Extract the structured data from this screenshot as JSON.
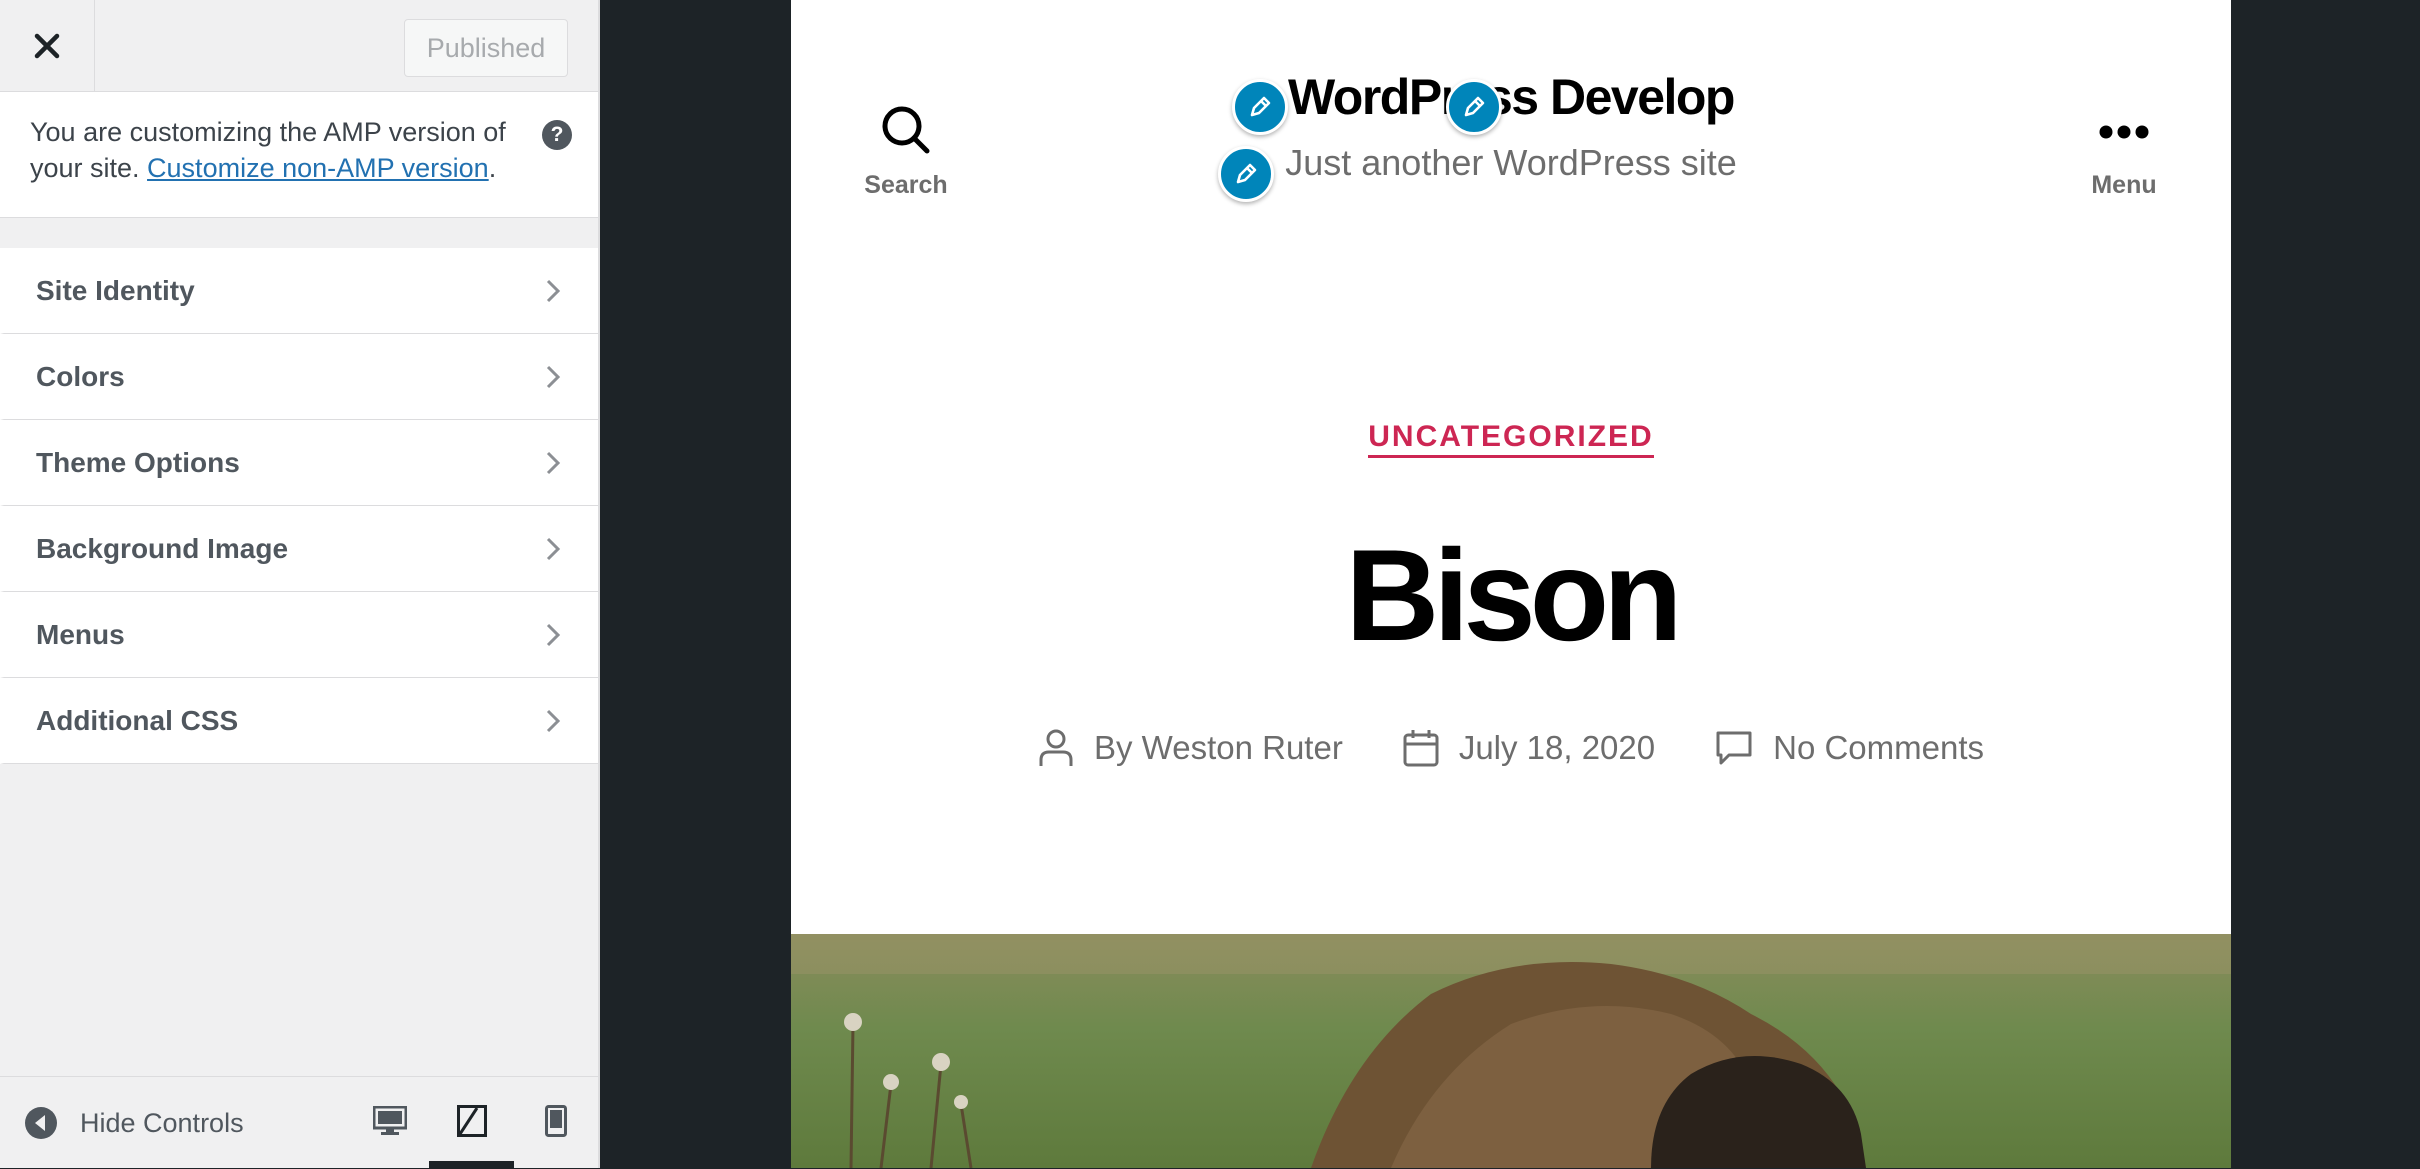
{
  "customizer": {
    "publish_label": "Published",
    "notice": {
      "text_before": "You are customizing the AMP version of your site. ",
      "link_text": "Customize non-AMP version",
      "text_after": "."
    },
    "sections": [
      {
        "label": "Site Identity"
      },
      {
        "label": "Colors"
      },
      {
        "label": "Theme Options"
      },
      {
        "label": "Background Image"
      },
      {
        "label": "Menus"
      },
      {
        "label": "Additional CSS"
      }
    ],
    "footer": {
      "hide_controls_label": "Hide Controls",
      "selected_device": "tablet"
    }
  },
  "preview": {
    "search_label": "Search",
    "menu_label": "Menu",
    "site_title": "WordPress Develop",
    "site_description": "Just another WordPress site",
    "category": "UNCATEGORIZED",
    "post_title": "Bison",
    "meta": {
      "author": "By Weston Ruter",
      "date": "July 18, 2020",
      "comments": "No Comments"
    }
  },
  "colors": {
    "accent": "#cd2653",
    "edit_shortcut": "#0085ba",
    "link": "#2271b1",
    "dark_bg": "#1d2327"
  }
}
